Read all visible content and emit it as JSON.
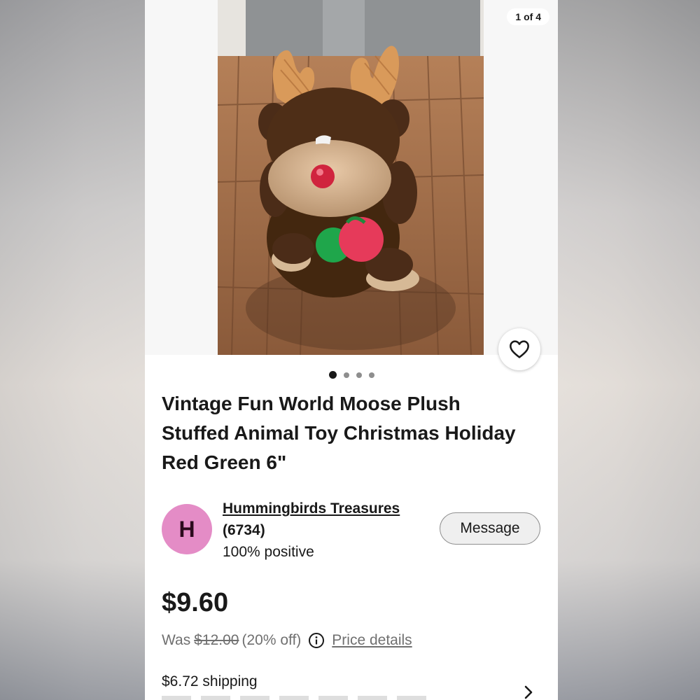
{
  "gallery": {
    "counter": "1 of 4",
    "dots": [
      true,
      false,
      false,
      false
    ]
  },
  "listing": {
    "title": "Vintage Fun World Moose Plush Stuffed Animal Toy Christmas Holiday Red Green 6\""
  },
  "seller": {
    "avatar_letter": "H",
    "name": "Hummingbirds Treasures",
    "feedback_count": "(6734)",
    "positive": "100% positive",
    "message_label": "Message"
  },
  "pricing": {
    "price": "$9.60",
    "was_label": "Was",
    "original": "$12.00",
    "discount": "(20% off)",
    "details_label": "Price details"
  },
  "shipping": {
    "cost": "$6.72 shipping"
  },
  "colors": {
    "avatar_bg": "#e48cc6",
    "text": "#191919",
    "muted": "#707070"
  },
  "icons": [
    "heart-icon",
    "info-icon",
    "chevron-right-icon"
  ]
}
